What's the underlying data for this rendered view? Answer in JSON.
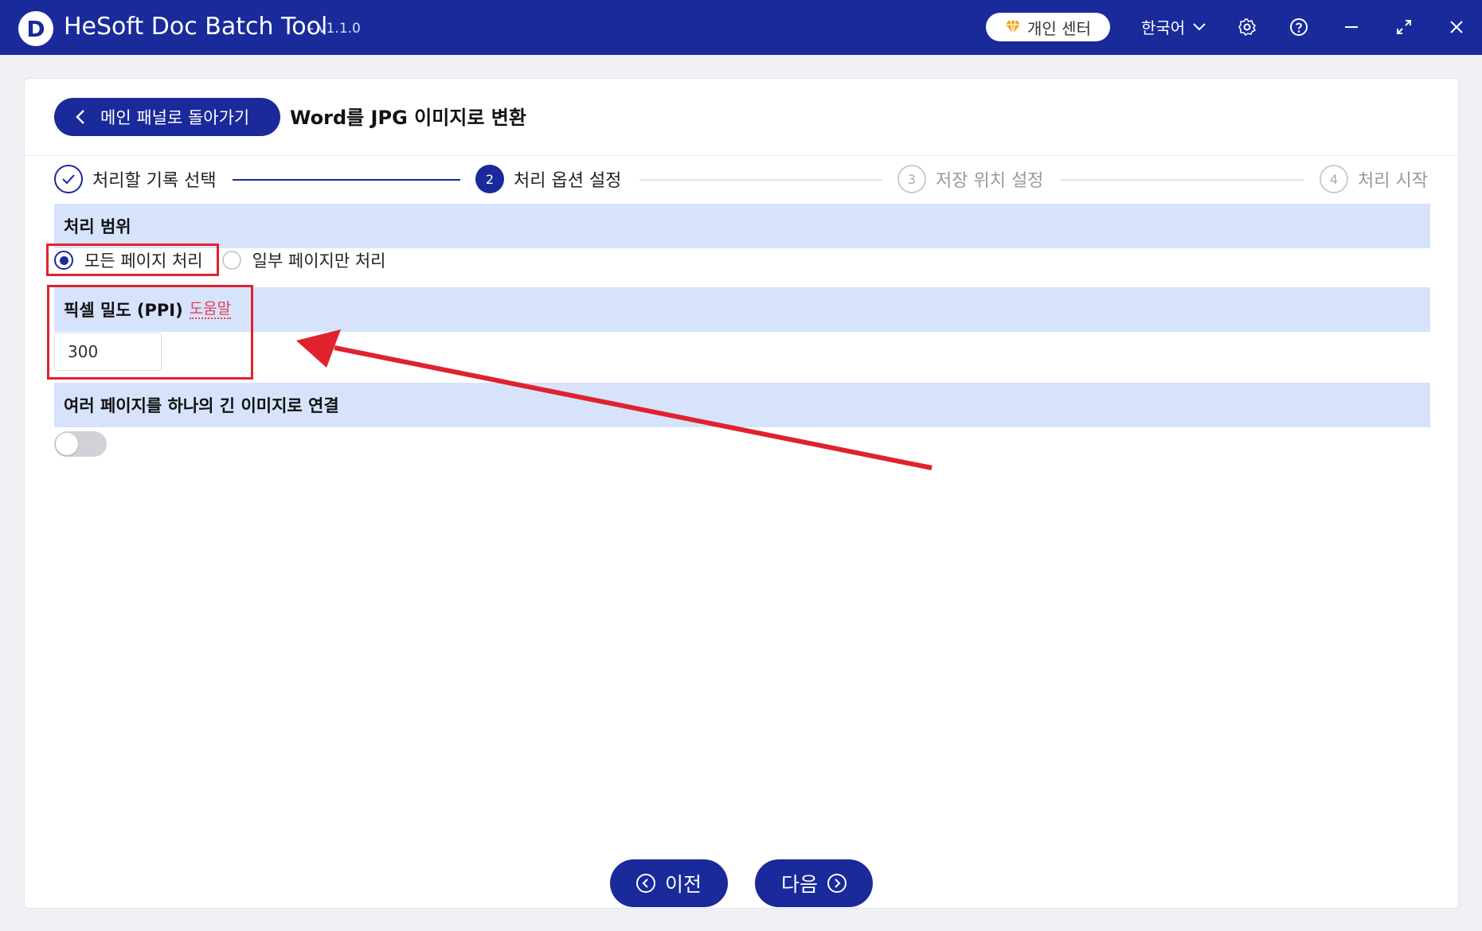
{
  "app": {
    "title": "HeSoft Doc Batch Tool",
    "version": "- v1.1.0",
    "logo_letter": "D",
    "user_center": "개인 센터",
    "language": "한국어"
  },
  "colors": {
    "primary": "#1a2a9b",
    "section_bg": "#d6e3fb",
    "highlight": "#e0222e",
    "help_link": "#e0405a"
  },
  "header": {
    "back_label": "메인 패널로 돌아가기",
    "page_title": "Word를 JPG 이미지로 변환"
  },
  "steps": [
    {
      "number": "✓",
      "label": "처리할 기록 선택",
      "state": "done"
    },
    {
      "number": "2",
      "label": "처리 옵션 설정",
      "state": "active"
    },
    {
      "number": "3",
      "label": "저장 위치 설정",
      "state": "todo"
    },
    {
      "number": "4",
      "label": "처리 시작",
      "state": "todo"
    }
  ],
  "range": {
    "title": "처리 범위",
    "options": [
      "모든 페이지 처리",
      "일부 페이지만 처리"
    ],
    "selected": "모든 페이지 처리"
  },
  "ppi": {
    "title": "픽셀 밀도 (PPI)",
    "help": "도움말",
    "value": "300"
  },
  "merge": {
    "title": "여러 페이지를 하나의 긴 이미지로 연결",
    "enabled": false
  },
  "nav": {
    "prev": "이전",
    "next": "다음"
  },
  "icons": {
    "user_center": "diamond-icon",
    "language": "chevron-down-icon",
    "settings": "gear-icon",
    "help": "question-icon",
    "minimize": "minimize-icon",
    "maximize": "maximize-icon",
    "close": "close-icon"
  }
}
